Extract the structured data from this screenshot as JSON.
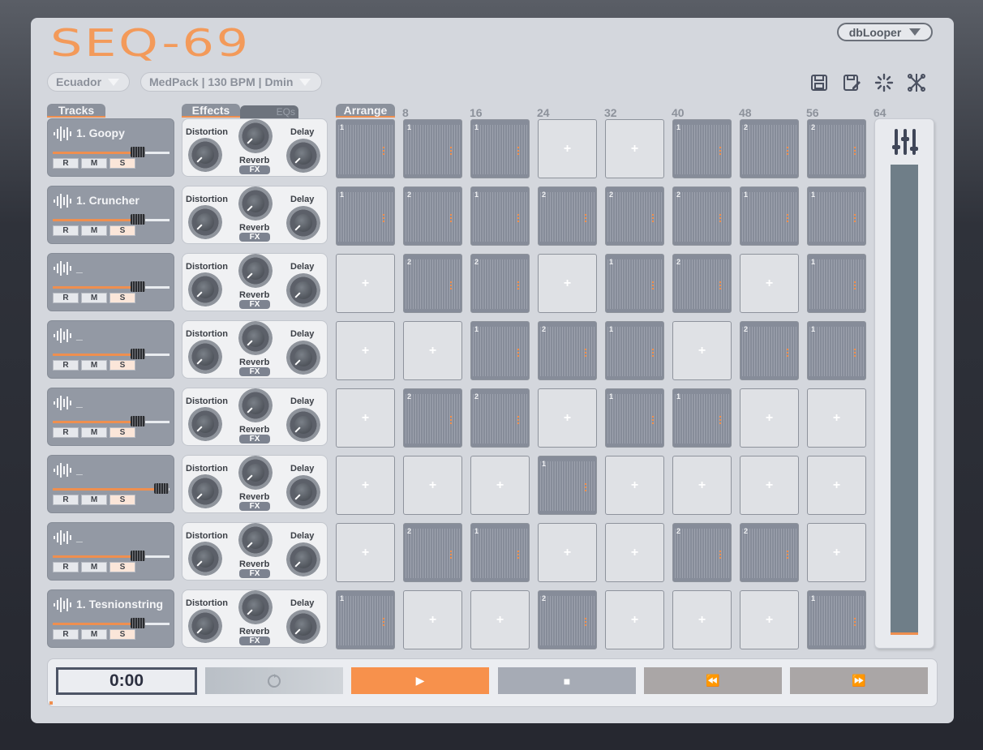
{
  "app": {
    "logo": "SEQ-69",
    "brand": "dbLooper"
  },
  "presets": {
    "project": "Ecuador",
    "pack": "MedPack | 130 BPM | Dmin"
  },
  "toolbar": {
    "icons": [
      "save-icon",
      "save-as-icon",
      "loading-icon",
      "network-icon"
    ]
  },
  "tabs": {
    "tracks": "Tracks",
    "effects": "Effects",
    "eqs": "EQs",
    "arrange": "Arrange"
  },
  "bar_numbers": [
    "8",
    "16",
    "24",
    "32",
    "40",
    "48",
    "56",
    "64"
  ],
  "track_buttons": {
    "record": "R",
    "mute": "M",
    "solo": "S"
  },
  "fx_labels": {
    "distortion": "Distortion",
    "delay": "Delay",
    "reverb": "Reverb",
    "fx": "FX"
  },
  "tracks": [
    {
      "name": "1. Goopy",
      "volume": 0.75
    },
    {
      "name": "1. Cruncher",
      "volume": 0.75
    },
    {
      "name": "_",
      "volume": 0.75
    },
    {
      "name": "_",
      "volume": 0.75
    },
    {
      "name": "_",
      "volume": 0.75
    },
    {
      "name": "_",
      "volume": 0.95
    },
    {
      "name": "_",
      "volume": 0.75
    },
    {
      "name": "1. Tesnionstring",
      "volume": 0.75
    }
  ],
  "arrange_grid": [
    [
      "1",
      "1",
      "1",
      "",
      "",
      "1",
      "2",
      "2"
    ],
    [
      "1",
      "2",
      "1",
      "2",
      "2",
      "2",
      "1",
      "1"
    ],
    [
      "",
      "2",
      "2",
      "",
      "1",
      "2",
      "",
      "1"
    ],
    [
      "",
      "",
      "1",
      "2",
      "1",
      "",
      "2",
      "1"
    ],
    [
      "",
      "2",
      "2",
      "",
      "1",
      "1",
      "",
      ""
    ],
    [
      "",
      "",
      "",
      "1",
      "",
      "",
      "",
      ""
    ],
    [
      "",
      "2",
      "1",
      "",
      "",
      "2",
      "2",
      ""
    ],
    [
      "1",
      "",
      "",
      "2",
      "",
      "",
      "",
      "1"
    ]
  ],
  "empty_cell_label": "+",
  "transport": {
    "time": "0:00",
    "play": "▶",
    "stop": "■",
    "rewind": "⏪",
    "forward": "⏩"
  },
  "colors": {
    "accent": "#ef8f4f",
    "panel": "#d4d7dd",
    "track_bg": "#9399a4",
    "clip_bg": "#868c99"
  }
}
